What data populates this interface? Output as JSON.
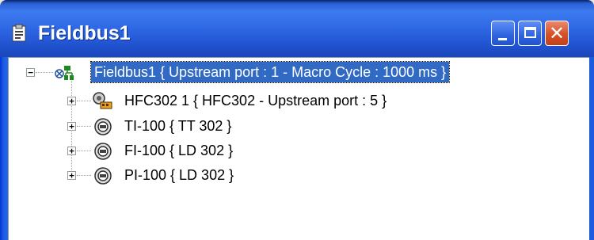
{
  "window": {
    "title": "Fieldbus1",
    "controls": {
      "minimize": "minimize",
      "maximize": "maximize",
      "close": "close"
    }
  },
  "tree": {
    "root": {
      "label": "Fieldbus1 {  Upstream port : 1 -  Macro Cycle : 1000 ms  }",
      "expander": "−",
      "icon": "fieldbus-network-icon",
      "selected": true
    },
    "children": [
      {
        "label": "HFC302 1 { HFC302 -  Upstream port : 5 }",
        "expander": "+",
        "icon": "bridge-device-icon"
      },
      {
        "label": "TI-100 { TT 302 }",
        "expander": "+",
        "icon": "field-device-icon"
      },
      {
        "label": "FI-100 { LD 302 }",
        "expander": "+",
        "icon": "field-device-icon"
      },
      {
        "label": "PI-100 { LD 302 }",
        "expander": "+",
        "icon": "field-device-icon"
      }
    ]
  },
  "colors": {
    "titlebar": "#2f67e4",
    "selection": "#316ac5",
    "close_button": "#d84f24"
  }
}
